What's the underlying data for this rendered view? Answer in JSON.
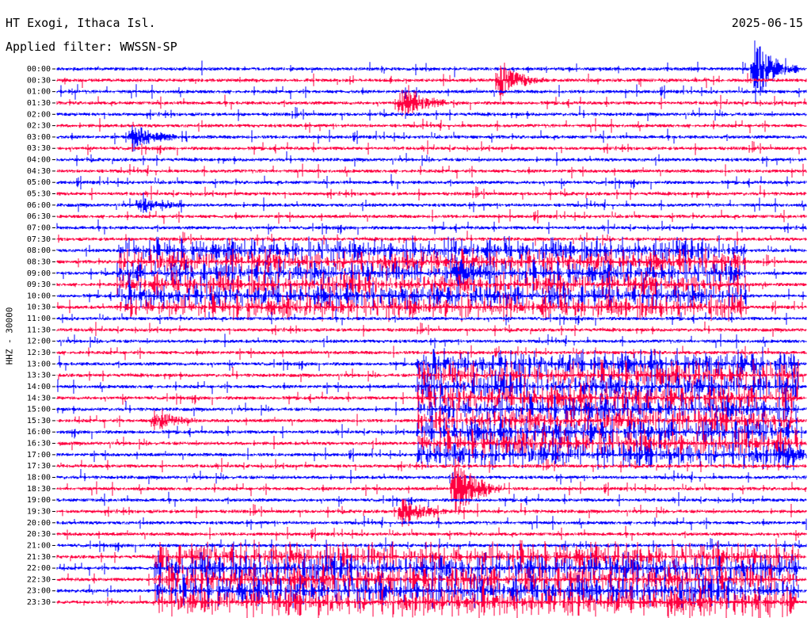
{
  "header": {
    "station": "HT Exogi, Ithaca Isl.",
    "filter": "Applied filter: WWSSN-SP",
    "date": "2025-06-15"
  },
  "chart_data": {
    "type": "line",
    "ylabel": "HHZ - 30000",
    "y_ticks": [
      "00:00",
      "00:30",
      "01:00",
      "01:30",
      "02:00",
      "02:30",
      "03:00",
      "03:30",
      "04:00",
      "04:30",
      "05:00",
      "05:30",
      "06:00",
      "06:30",
      "07:00",
      "07:30",
      "08:00",
      "08:30",
      "09:00",
      "09:30",
      "10:00",
      "10:30",
      "11:00",
      "11:30",
      "12:00",
      "12:30",
      "13:00",
      "13:30",
      "14:00",
      "14:30",
      "15:00",
      "15:30",
      "16:00",
      "16:30",
      "17:00",
      "17:30",
      "18:00",
      "18:30",
      "19:00",
      "19:30",
      "20:00",
      "20:30",
      "21:00",
      "21:30",
      "22:00",
      "22:30",
      "23:00",
      "23:30"
    ],
    "line_colors": [
      "#0000ff",
      "#ff0040"
    ],
    "events": [
      {
        "time": "00:00",
        "at": 0.93,
        "amp": 3.5
      },
      {
        "time": "00:30",
        "at": 0.59,
        "amp": 2.2
      },
      {
        "time": "01:30",
        "at": 0.46,
        "amp": 2.5
      },
      {
        "time": "03:00",
        "at": 0.1,
        "amp": 1.6
      },
      {
        "time": "06:00",
        "at": 0.11,
        "amp": 0.9
      },
      {
        "time": "09:00",
        "at": 0.53,
        "amp": 1.2
      },
      {
        "time": "15:30",
        "at": 0.13,
        "amp": 1.2
      },
      {
        "time": "18:30",
        "at": 0.53,
        "amp": 3.8
      },
      {
        "time": "19:30",
        "at": 0.46,
        "amp": 1.6
      },
      {
        "time": "17:00",
        "at": 0.97,
        "amp": 1.3
      }
    ],
    "activity": [
      {
        "from": "08:00",
        "to": "10:30",
        "start": 0.08,
        "end": 0.92,
        "amp": 1.2
      },
      {
        "from": "13:00",
        "to": "17:00",
        "start": 0.48,
        "end": 0.99,
        "amp": 1.4
      },
      {
        "from": "21:30",
        "to": "23:30",
        "start": 0.13,
        "end": 0.99,
        "amp": 1.5
      }
    ]
  }
}
